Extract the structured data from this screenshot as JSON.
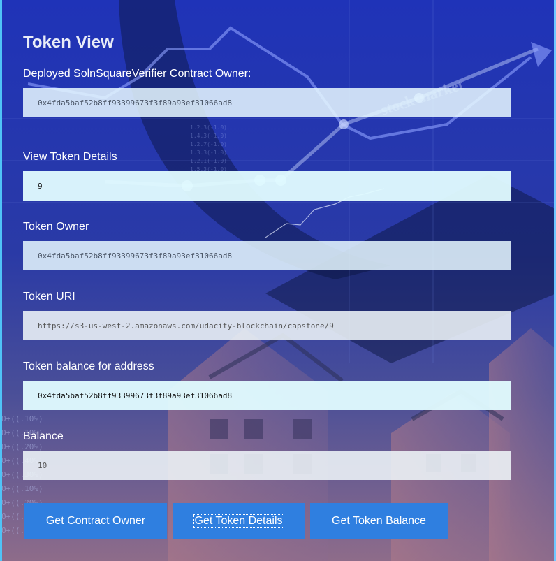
{
  "page": {
    "title": "Token View"
  },
  "owner_section": {
    "label": "Deployed SolnSquareVerifier Contract Owner:",
    "value": "0x4fda5baf52b8ff93399673f3f89a93ef31066ad8"
  },
  "token_details": {
    "label": "View Token Details",
    "value": "9"
  },
  "token_owner": {
    "label": "Token Owner",
    "value": "0x4fda5baf52b8ff93399673f3f89a93ef31066ad8"
  },
  "token_uri": {
    "label": "Token URI",
    "value": "https://s3-us-west-2.amazonaws.com/udacity-blockchain/capstone/9"
  },
  "balance_address": {
    "label": "Token balance for address",
    "value": "0x4fda5baf52b8ff93399673f3f89a93ef31066ad8"
  },
  "balance": {
    "label": "Balance",
    "value": "10"
  },
  "buttons": {
    "get_contract_owner": "Get Contract Owner",
    "get_token_details": "Get Token Details",
    "get_token_balance": "Get Token Balance"
  },
  "background": {
    "watermark": "stock market",
    "icons": [
      "line-chart",
      "houses",
      "percentage-table"
    ]
  },
  "colors": {
    "button": "#2f7fe0",
    "accent_border": "#4fc3f7"
  }
}
